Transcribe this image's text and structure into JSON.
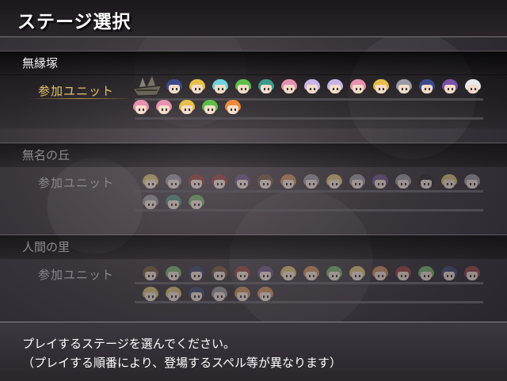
{
  "header": {
    "title": "ステージ選択"
  },
  "stages": [
    {
      "name": "無縁塚",
      "unit_label": "参加ユニット",
      "selected": true,
      "row1": [
        "boat-vessel",
        "navy",
        "blonde",
        "cyan",
        "green",
        "teal",
        "pink",
        "lavender",
        "lavender",
        "pink",
        "blonde",
        "grey",
        "navy",
        "purple",
        "white"
      ],
      "row2": [
        "pink",
        "pink",
        "blonde",
        "green",
        "orange"
      ]
    },
    {
      "name": "無名の丘",
      "unit_label": "参加ユニット",
      "selected": false,
      "row1": [
        "blonde",
        "grey",
        "red",
        "red",
        "purple",
        "brown",
        "orange",
        "grey",
        "blonde",
        "grey",
        "purple",
        "grey",
        "black",
        "blonde",
        "grey"
      ],
      "row2": [
        "grey",
        "teal",
        "green"
      ]
    },
    {
      "name": "人間の里",
      "unit_label": "参加ユニット",
      "selected": false,
      "row1": [
        "brown",
        "green",
        "navy",
        "brown",
        "red",
        "purple",
        "blonde",
        "orange",
        "green",
        "blonde",
        "orange",
        "red",
        "green",
        "navy",
        "red"
      ],
      "row2": [
        "blonde",
        "blonde",
        "navy",
        "grey",
        "orange",
        "orange"
      ]
    }
  ],
  "colors": {
    "blonde": "#e6c04a",
    "navy": "#3a4a8c",
    "cyan": "#6fd2e0",
    "green": "#5cbf4a",
    "teal": "#3a9a8a",
    "pink": "#e890b0",
    "lavender": "#c8b4e8",
    "grey": "#9a9aa6",
    "purple": "#7a52a8",
    "white": "#e8e8f0",
    "orange": "#e88a3a",
    "red": "#c23a3a",
    "brown": "#8a5a32",
    "black": "#2a2a32",
    "boat-vessel": "#6a6a60"
  },
  "footer": {
    "line1": "プレイするステージを選んでください。",
    "line2": "（プレイする順番により、登場するスペル等が異なります）"
  }
}
